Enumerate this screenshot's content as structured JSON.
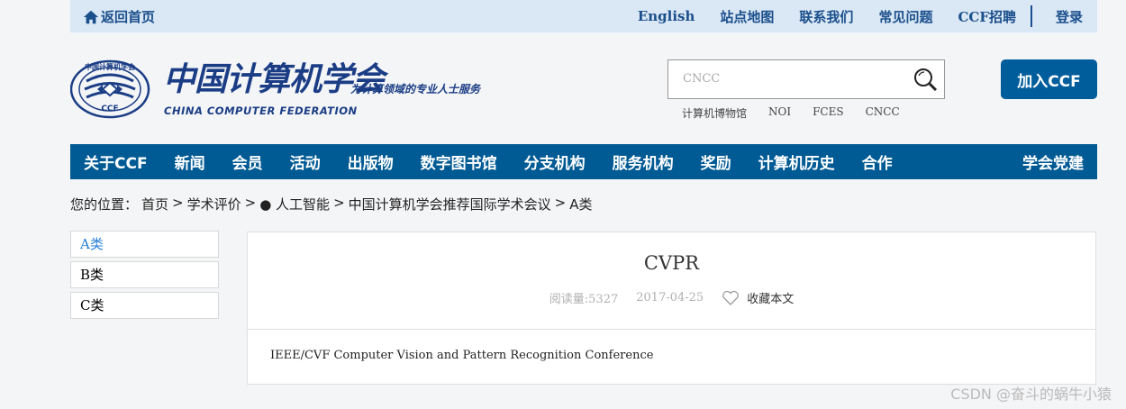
{
  "topbar": {
    "home_label": "返回首页",
    "links": [
      "English",
      "站点地图",
      "联系我们",
      "常见问题",
      "CCF招聘"
    ],
    "login": "登录"
  },
  "logo": {
    "cn_name": "中国计算机学会",
    "slogan": "为计算领域的专业人士服务",
    "en_name": "CHINA COMPUTER FEDERATION",
    "emblem_top_text": "中国计算机学会",
    "emblem_bottom_text": "CCF"
  },
  "search": {
    "placeholder": "CNCC",
    "quick_links": [
      "计算机博物馆",
      "NOI",
      "FCES",
      "CNCC"
    ]
  },
  "join_button": "加入CCF",
  "nav": {
    "items": [
      "关于CCF",
      "新闻",
      "会员",
      "活动",
      "出版物",
      "数字图书馆",
      "分支机构",
      "服务机构",
      "奖励",
      "计算机历史",
      "合作"
    ],
    "right_item": "学会党建"
  },
  "breadcrumb": {
    "prefix": "您的位置：",
    "items": [
      "首页",
      "学术评价",
      "● 人工智能",
      "中国计算机学会推荐国际学术会议",
      "A类"
    ],
    "separator": ">"
  },
  "sidebar": {
    "items": [
      {
        "label": "A类",
        "active": true
      },
      {
        "label": "B类",
        "active": false
      },
      {
        "label": "C类",
        "active": false
      }
    ]
  },
  "article": {
    "title": "CVPR",
    "read_count": "阅读量:5327",
    "date": "2017-04-25",
    "favorite_label": "收藏本文",
    "body": "IEEE/CVF Computer Vision and Pattern Recognition Conference"
  },
  "watermark": "CSDN @奋斗的蜗牛小猿",
  "colors": {
    "primary": "#005a94",
    "topbar_bg": "#dae7f4",
    "brand_text": "#1a3d85",
    "active_link": "#2a7fd4"
  }
}
